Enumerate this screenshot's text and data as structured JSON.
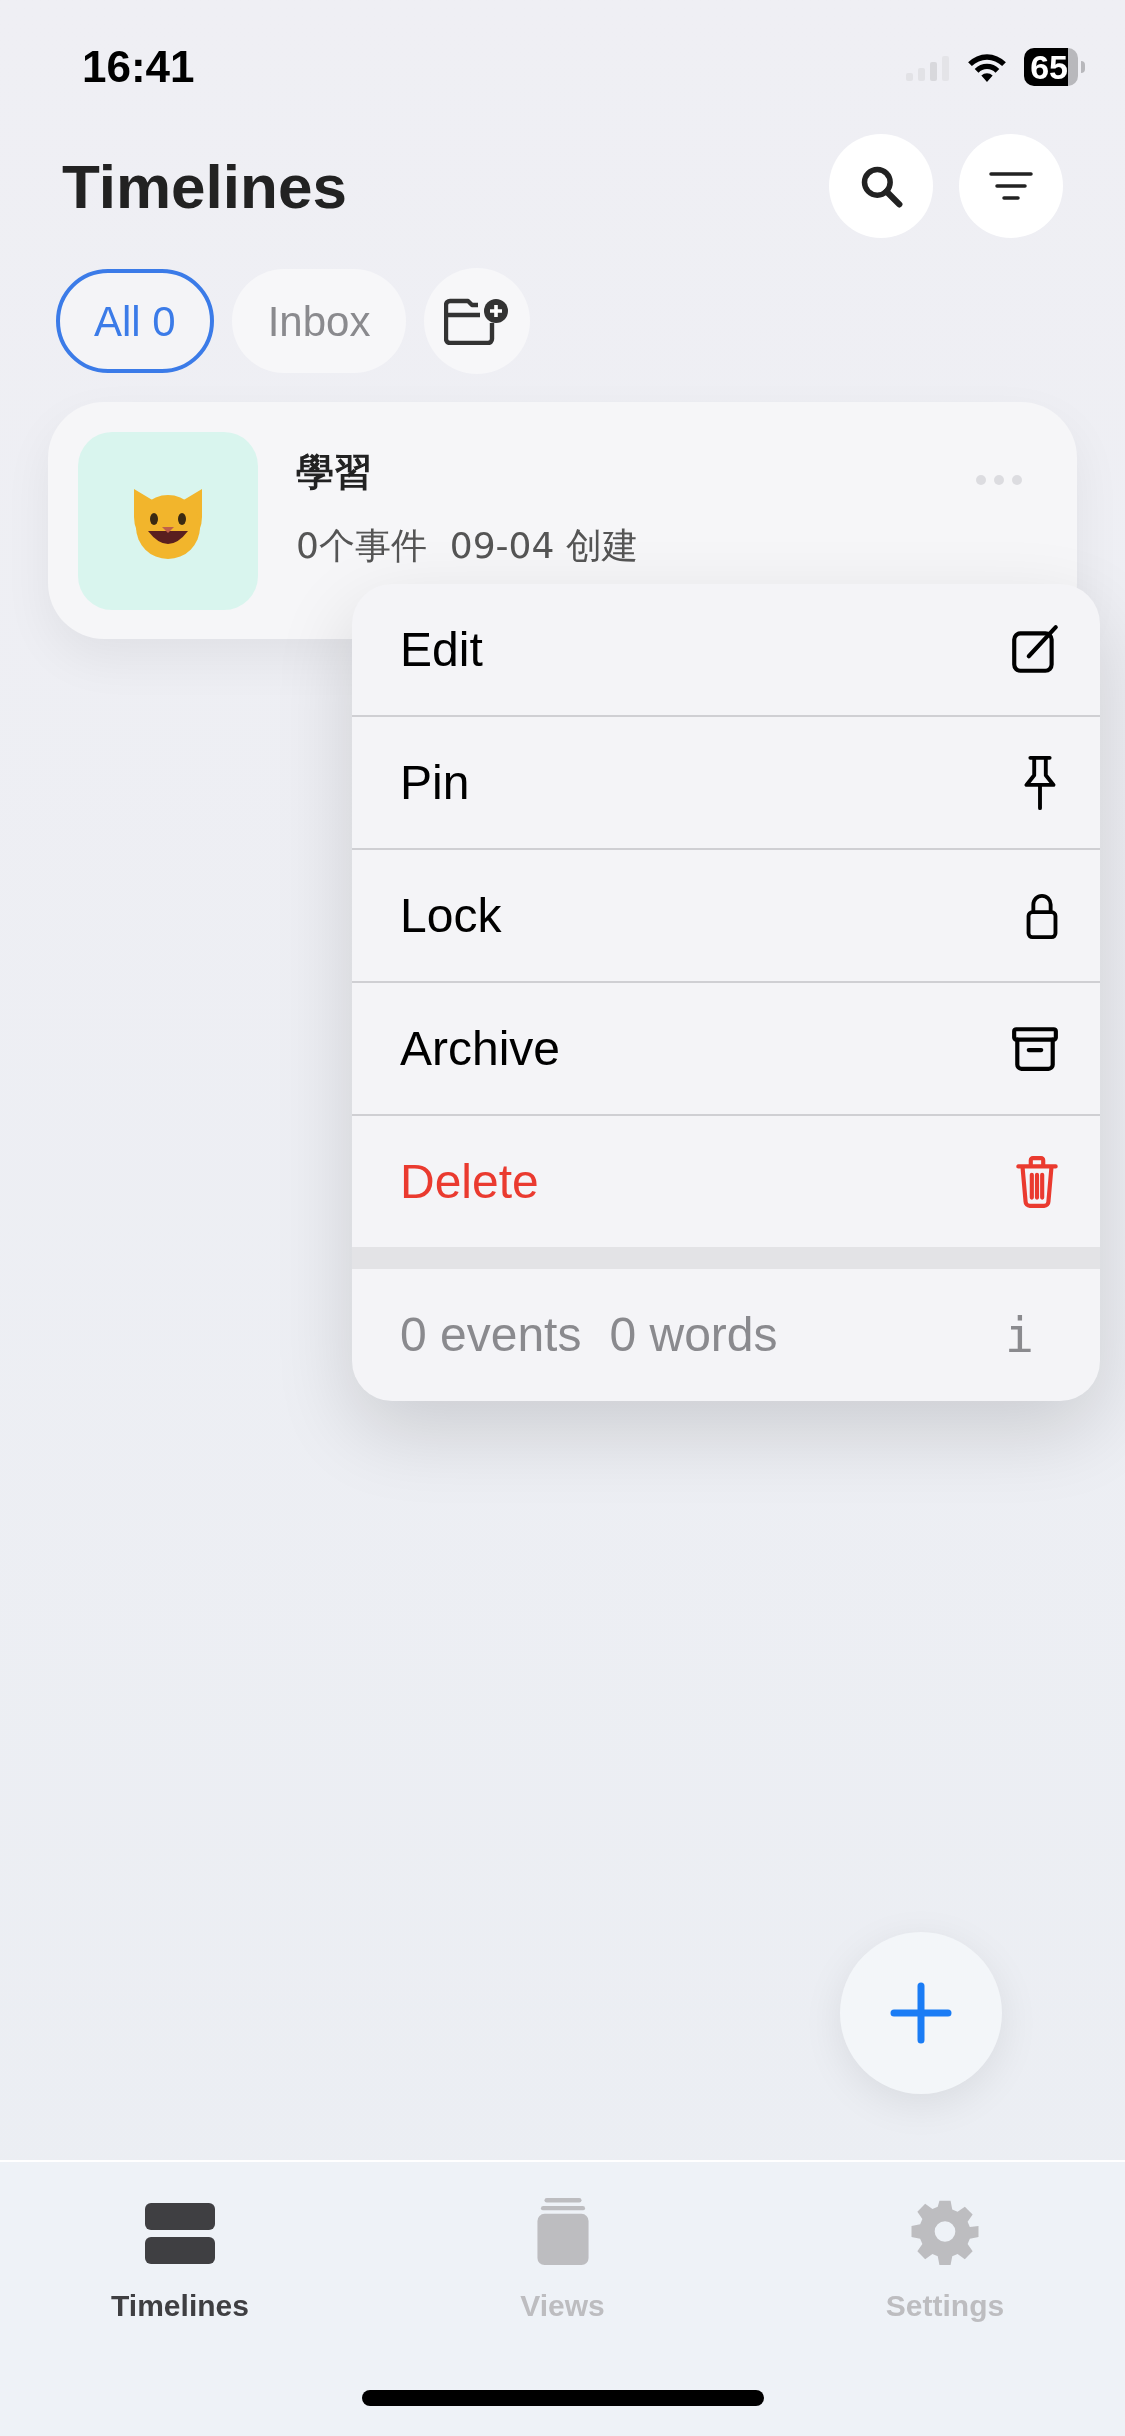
{
  "status_bar": {
    "time": "16:41",
    "battery": "65"
  },
  "header": {
    "title": "Timelines"
  },
  "filters": [
    {
      "label": "All 0",
      "selected": true
    },
    {
      "label": "Inbox",
      "selected": false
    }
  ],
  "timelines": [
    {
      "title": "學習",
      "subtitle": "0个事件  09-04 创建"
    }
  ],
  "context_menu": {
    "items": [
      {
        "label": "Edit",
        "kind": "normal"
      },
      {
        "label": "Pin",
        "kind": "normal"
      },
      {
        "label": "Lock",
        "kind": "normal"
      },
      {
        "label": "Archive",
        "kind": "normal"
      },
      {
        "label": "Delete",
        "kind": "destructive"
      }
    ],
    "footer": {
      "events": "0 events",
      "words": "0 words",
      "info": "i"
    }
  },
  "tab_bar": [
    {
      "label": "Timelines",
      "selected": true
    },
    {
      "label": "Views",
      "selected": false
    },
    {
      "label": "Settings",
      "selected": false
    }
  ]
}
